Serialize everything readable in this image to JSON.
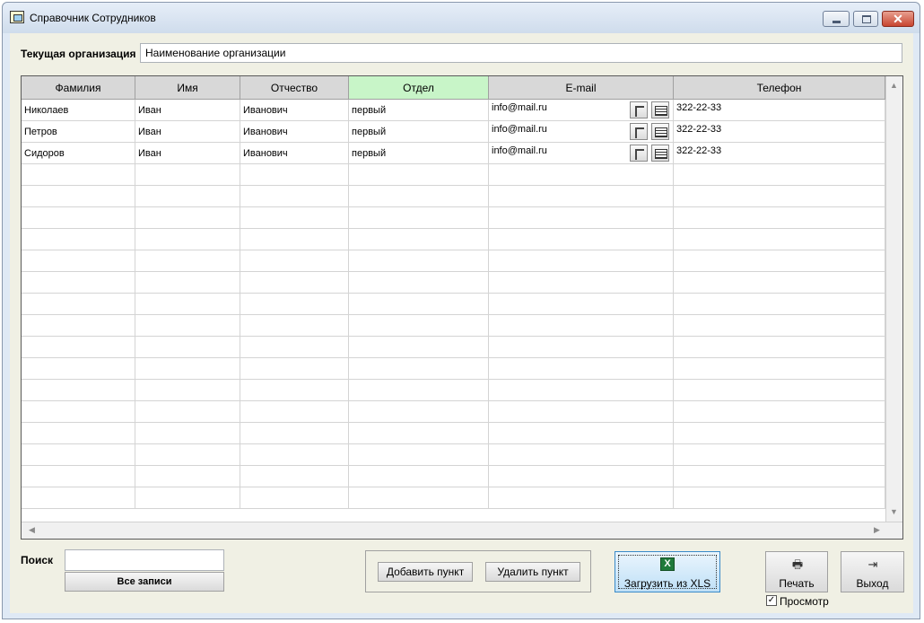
{
  "window": {
    "title": "Справочник Сотрудников",
    "close_glyph": "✕"
  },
  "organization": {
    "label": "Текущая организация",
    "value": "Наименование организации"
  },
  "table": {
    "columns": [
      "Фамилия",
      "Имя",
      "Отчество",
      "Отдел",
      "E-mail",
      "Телефон"
    ],
    "active_column": "Отдел",
    "active_column_color": "#c8f5c8",
    "rows": [
      {
        "surname": "Николаев",
        "name": "Иван",
        "patronymic": "Иванович",
        "department": "первый",
        "email": "info@mail.ru",
        "phone": "322-22-33"
      },
      {
        "surname": "Петров",
        "name": "Иван",
        "patronymic": "Иванович",
        "department": "первый",
        "email": "info@mail.ru",
        "phone": "322-22-33"
      },
      {
        "surname": "Сидоров",
        "name": "Иван",
        "patronymic": "Иванович",
        "department": "первый",
        "email": "info@mail.ru",
        "phone": "322-22-33"
      }
    ],
    "email_action_icons": [
      "mail-open-icon",
      "table-icon"
    ]
  },
  "search": {
    "label": "Поиск",
    "value": "",
    "all_records_label": "Все записи"
  },
  "actions": {
    "add_label": "Добавить пункт",
    "delete_label": "Удалить пункт",
    "xls_label": "Загрузить из XLS",
    "xls_icon_letter": "X",
    "xls_icon": "excel-icon",
    "print_label": "Печать",
    "print_icon": "printer-icon",
    "print_glyph": "🖶",
    "exit_label": "Выход",
    "exit_icon": "exit-door-icon",
    "exit_glyph": "⇥"
  },
  "preview": {
    "label": "Просмотр",
    "checked": true,
    "check_glyph": "✓"
  }
}
